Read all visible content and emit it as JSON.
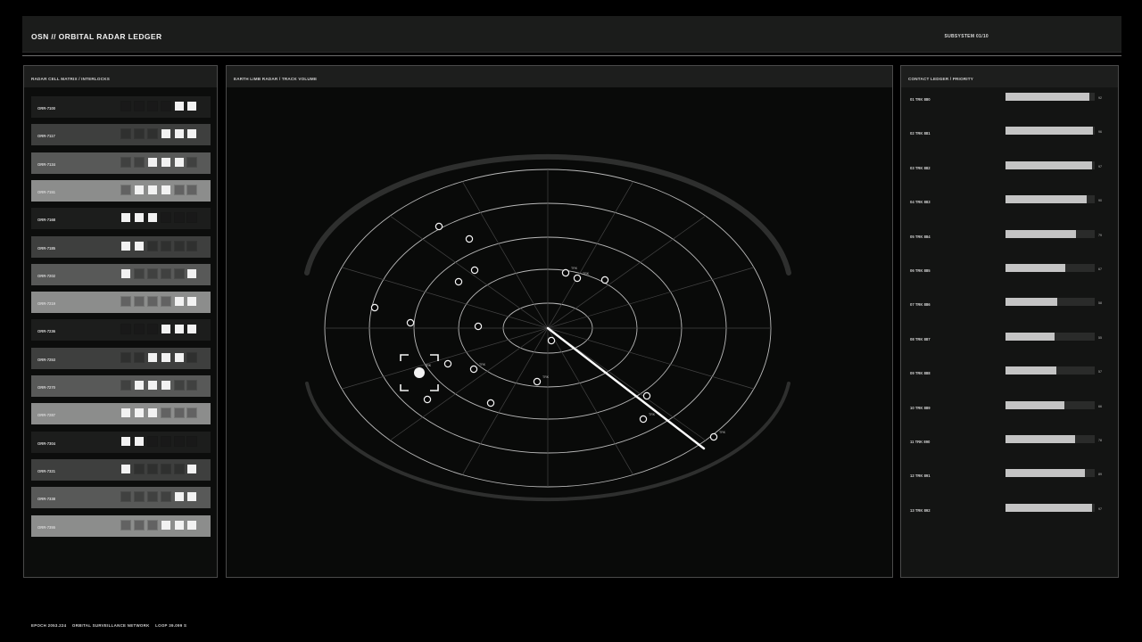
{
  "header": {
    "title": "OSN // ORBITAL RADAR LEDGER",
    "subsystem": "SUBSYSTEM 01/10"
  },
  "left_panel": {
    "title": "RADAR CELL MATRIX / INTERLOCKS",
    "cells": [
      {
        "id": "ORR-7100",
        "shade": "#1c1d1c",
        "states": [
          0,
          0,
          0,
          0,
          1,
          1
        ]
      },
      {
        "id": "ORR-7117",
        "shade": "#3e3f3e",
        "states": [
          0,
          0,
          0,
          1,
          1,
          1
        ]
      },
      {
        "id": "ORR-7134",
        "shade": "#585958",
        "states": [
          0,
          0,
          1,
          1,
          1,
          0
        ]
      },
      {
        "id": "ORR-7151",
        "shade": "#8c8d8c",
        "states": [
          0,
          1,
          1,
          1,
          0,
          0
        ]
      },
      {
        "id": "ORR-7168",
        "shade": "#1c1d1c",
        "states": [
          1,
          1,
          1,
          0,
          0,
          0
        ]
      },
      {
        "id": "ORR-7185",
        "shade": "#3e3f3e",
        "states": [
          1,
          1,
          0,
          0,
          0,
          0
        ]
      },
      {
        "id": "ORR-7202",
        "shade": "#585958",
        "states": [
          1,
          0,
          0,
          0,
          0,
          1
        ]
      },
      {
        "id": "ORR-7219",
        "shade": "#8c8d8c",
        "states": [
          0,
          0,
          0,
          0,
          1,
          1
        ]
      },
      {
        "id": "ORR-7236",
        "shade": "#1c1d1c",
        "states": [
          0,
          0,
          0,
          1,
          1,
          1
        ]
      },
      {
        "id": "ORR-7253",
        "shade": "#3e3f3e",
        "states": [
          0,
          0,
          1,
          1,
          1,
          0
        ]
      },
      {
        "id": "ORR-7270",
        "shade": "#585958",
        "states": [
          0,
          1,
          1,
          1,
          0,
          0
        ]
      },
      {
        "id": "ORR-7287",
        "shade": "#8c8d8c",
        "states": [
          1,
          1,
          1,
          0,
          0,
          0
        ]
      },
      {
        "id": "ORR-7304",
        "shade": "#1c1d1c",
        "states": [
          1,
          1,
          0,
          0,
          0,
          0
        ]
      },
      {
        "id": "ORR-7321",
        "shade": "#3e3f3e",
        "states": [
          1,
          0,
          0,
          0,
          0,
          1
        ]
      },
      {
        "id": "ORR-7338",
        "shade": "#585958",
        "states": [
          0,
          0,
          0,
          0,
          1,
          1
        ]
      },
      {
        "id": "ORR-7355",
        "shade": "#8c8d8c",
        "states": [
          0,
          0,
          0,
          1,
          1,
          1
        ]
      }
    ]
  },
  "center_panel": {
    "title": "EARTH LIMB RADAR / TRACK VOLUME",
    "colors": {
      "rings": "#b9b9b9",
      "spokes": "#444444",
      "limb": "#2e2f2e",
      "sweep": "#ffffff"
    },
    "blips": [
      {
        "label": ""
      },
      {
        "label": ""
      },
      {
        "label": ""
      },
      {
        "label": ""
      },
      {
        "label": ""
      },
      {
        "label": "TRK"
      },
      {
        "label": "TRK"
      },
      {
        "label": ""
      },
      {
        "label": ""
      },
      {
        "label": ""
      },
      {
        "label": ""
      },
      {
        "label": "TRK"
      },
      {
        "label": ""
      },
      {
        "label": "TRK"
      },
      {
        "label": ""
      },
      {
        "label": ""
      },
      {
        "label": ""
      },
      {
        "label": "TRK"
      }
    ],
    "selected_label": "TRK"
  },
  "right_panel": {
    "title": "CONTACT LEDGER / PRIORITY",
    "tracks": [
      {
        "label": "01  TRK 880",
        "priority": 0.94,
        "value": "92"
      },
      {
        "label": "02  TRK 881",
        "priority": 0.98,
        "value": "96"
      },
      {
        "label": "03  TRK 882",
        "priority": 0.97,
        "value": "97"
      },
      {
        "label": "04  TRK 883",
        "priority": 0.91,
        "value": "90"
      },
      {
        "label": "05  TRK 884",
        "priority": 0.79,
        "value": "79"
      },
      {
        "label": "06  TRK 885",
        "priority": 0.67,
        "value": "67"
      },
      {
        "label": "07  TRK 886",
        "priority": 0.58,
        "value": "58"
      },
      {
        "label": "08  TRK 887",
        "priority": 0.55,
        "value": "55"
      },
      {
        "label": "09  TRK 888",
        "priority": 0.57,
        "value": "57"
      },
      {
        "label": "10  TRK 889",
        "priority": 0.66,
        "value": "66"
      },
      {
        "label": "11  TRK 890",
        "priority": 0.78,
        "value": "78"
      },
      {
        "label": "12  TRK 891",
        "priority": 0.89,
        "value": "89"
      },
      {
        "label": "13  TRK 892",
        "priority": 0.97,
        "value": "97"
      }
    ]
  },
  "footer": {
    "epoch": "EPOCH 2053.224",
    "network": "ORBITAL SURVEILLANCE NETWORK",
    "loop": "LOOP 39.099 S"
  }
}
